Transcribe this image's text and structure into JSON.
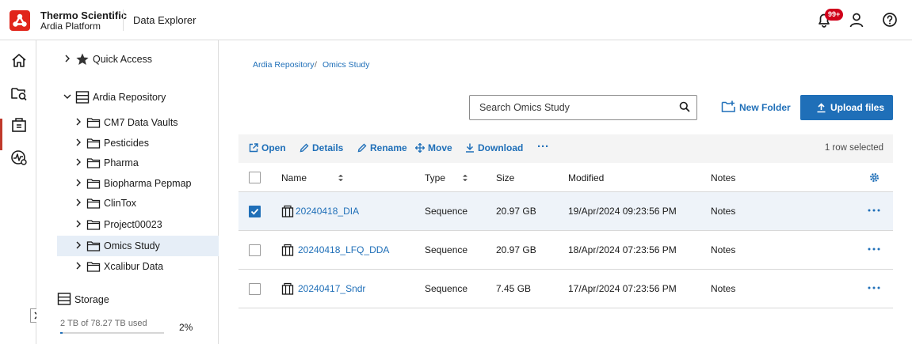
{
  "header": {
    "brand_line1": "Thermo Scientific",
    "brand_line2": "Ardia Platform",
    "app_name": "Data Explorer",
    "notification_badge": "99+"
  },
  "tree": {
    "items": [
      {
        "label": "Quick Access",
        "icon": "star-icon",
        "level": 0,
        "expanded": false
      },
      {
        "label": "Ardia Repository",
        "icon": "repository-icon",
        "level": 0,
        "expanded": true
      },
      {
        "label": "CM7 Data Vaults",
        "icon": "folder-icon",
        "level": 1
      },
      {
        "label": "Pesticides",
        "icon": "folder-icon",
        "level": 1
      },
      {
        "label": "Pharma",
        "icon": "folder-icon",
        "level": 1
      },
      {
        "label": "Biopharma Pepmap",
        "icon": "folder-icon",
        "level": 1
      },
      {
        "label": "ClinTox",
        "icon": "folder-icon",
        "level": 1
      },
      {
        "label": "Project00023",
        "icon": "folder-icon",
        "level": 1
      },
      {
        "label": "Omics Study",
        "icon": "folder-icon",
        "level": 1,
        "selected": true
      },
      {
        "label": "Xcalibur Data",
        "icon": "folder-icon",
        "level": 1
      }
    ],
    "storage": {
      "label": "Storage",
      "used_text": "2 TB of 78.27 TB used",
      "percent_text": "2%",
      "fraction": 0.02
    }
  },
  "breadcrumb": {
    "items": [
      "Ardia Repository",
      "Omics Study"
    ],
    "separator": "/"
  },
  "search": {
    "placeholder": "Search Omics Study"
  },
  "actions": {
    "new_folder": "New Folder",
    "upload": "Upload files"
  },
  "toolbar": {
    "open": "Open",
    "details": "Details",
    "rename": "Rename",
    "move": "Move",
    "download": "Download",
    "more": "···",
    "selection_status": "1 row selected"
  },
  "table": {
    "columns": [
      "Name",
      "Type",
      "Size",
      "Modified",
      "Notes"
    ],
    "rows": [
      {
        "name": "20240418_DIA",
        "type": "Sequence",
        "size": "20.97 GB",
        "modified": "19/Apr/2024 09:23:56 PM",
        "notes": "Notes",
        "checked": true
      },
      {
        "name": "20240418_LFQ_DDA",
        "type": "Sequence",
        "size": "20.97 GB",
        "modified": "18/Apr/2024 07:23:56 PM",
        "notes": "Notes",
        "checked": false
      },
      {
        "name": "20240417_Sndr",
        "type": "Sequence",
        "size": "7.45 GB",
        "modified": "17/Apr/2024 07:23:56 PM",
        "notes": "Notes",
        "checked": false
      }
    ]
  },
  "colors": {
    "accent": "#1f6fb8",
    "brand": "#e1251b",
    "badge": "#d0021b",
    "selected_row": "#eef3f9"
  }
}
